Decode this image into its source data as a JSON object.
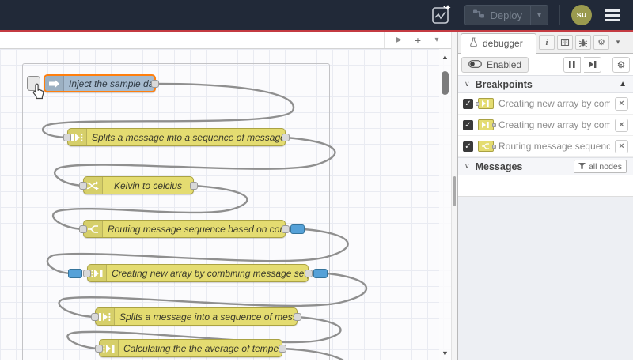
{
  "header": {
    "deploy": {
      "label": "Deploy"
    },
    "avatar": {
      "initials": "su"
    }
  },
  "canvas": {
    "nodes": [
      {
        "label": "Inject the sample data",
        "type": "inject",
        "selected": true
      },
      {
        "label": "Splits a message into a sequence of messages.",
        "type": "split"
      },
      {
        "label": "Kelvin to celcius",
        "type": "change"
      },
      {
        "label": "Routing message sequence based on condition",
        "type": "switch",
        "breakpoint_out": true
      },
      {
        "label": "Creating new array by combining message sequence",
        "type": "join",
        "breakpoint_in": true,
        "breakpoint_out": true
      },
      {
        "label": "Splits a message into a sequence of messages.",
        "type": "split"
      },
      {
        "label": "Calculating the the average of temperature",
        "type": "join"
      }
    ]
  },
  "sidebar": {
    "tab_label": "debugger",
    "toolbar": {
      "enabled_label": "Enabled"
    },
    "breakpoints": {
      "title": "Breakpoints",
      "items": [
        {
          "label": "Creating new array by combining message sequence",
          "node_type": "join",
          "port": "input"
        },
        {
          "label": "Creating new array by combining message sequence",
          "node_type": "join",
          "port": "output"
        },
        {
          "label": "Routing message sequence based on condition",
          "node_type": "switch",
          "port": "output"
        }
      ]
    },
    "messages": {
      "title": "Messages",
      "filter_label": "all nodes"
    }
  },
  "icons": {
    "play": "▶",
    "add": "+",
    "list_caret": "▾",
    "deploy_caret": "▾",
    "scroll_up": "▲",
    "scroll_down": "▼",
    "pin": "▲",
    "chevron_down": "∨",
    "close": "×",
    "gear": "⚙",
    "info": "i",
    "check": "✓",
    "tab_caret": "▾"
  }
}
